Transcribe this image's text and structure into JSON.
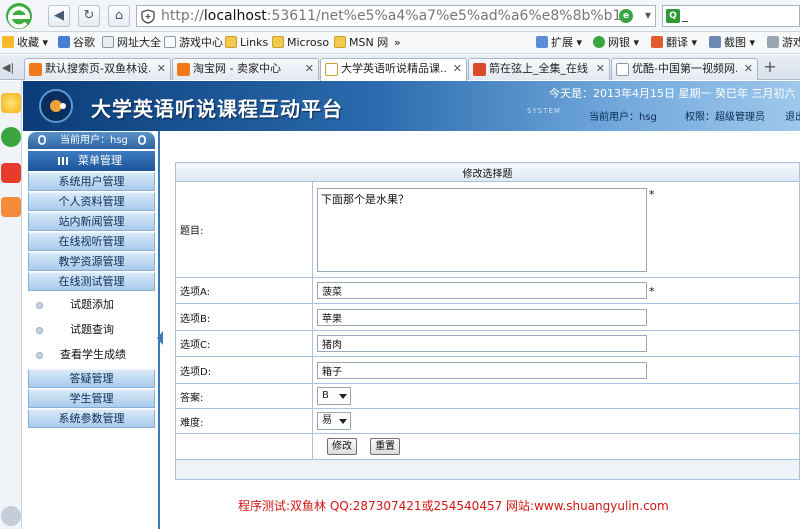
{
  "browser": {
    "url_prefix": "http://",
    "url_host": "localhost",
    "url_rest": ":53611/net%e5%a4%a7%e5%ad%a6%e8%8b%b1%e8%af%a",
    "search_cursor": "_",
    "new_tab_label": "+"
  },
  "favorites": {
    "left": [
      {
        "label": "收藏",
        "icon": "star-icon"
      },
      {
        "label": "谷歌",
        "icon": "google-icon"
      },
      {
        "label": "网址大全",
        "icon": "url-directory-icon"
      },
      {
        "label": "游戏中心",
        "icon": "page-icon"
      },
      {
        "label": "Links",
        "icon": "folder-icon"
      },
      {
        "label": "Microso",
        "icon": "folder-icon"
      },
      {
        "label": "MSN 网",
        "icon": "folder-icon"
      },
      {
        "label": "»",
        "icon": ""
      }
    ],
    "right": [
      {
        "label": "扩展",
        "icon": "extensions-icon"
      },
      {
        "label": "网银",
        "icon": "netbank-icon"
      },
      {
        "label": "翻译",
        "icon": "translate-icon"
      },
      {
        "label": "截图",
        "icon": "screenshot-icon"
      },
      {
        "label": "游戏",
        "icon": "game-icon"
      }
    ]
  },
  "tabs": [
    {
      "label": "默认搜索页-双鱼林设...",
      "icon": "taobao-icon"
    },
    {
      "label": "淘宝网 - 卖家中心",
      "icon": "taobao-icon"
    },
    {
      "label": "大学英语听说精品课...",
      "icon": "asp-icon",
      "active": true
    },
    {
      "label": "箭在弦上_全集_在线...",
      "icon": "ku-icon"
    },
    {
      "label": "优酷-中国第一视频网...",
      "icon": "page-icon"
    }
  ],
  "header": {
    "title": "大学英语听说课程互动平台",
    "today": "今天是：2013年4月15日 星期一 癸巳年 三月初六",
    "system_tag": "SYSTEM",
    "current_user": "当前用户：hsg",
    "permission": "权限：超级管理员",
    "logout": "退出"
  },
  "sidebar": {
    "current_user": "当前用户：hsg",
    "menu_title": "菜单管理",
    "groups": [
      {
        "label": "系统用户管理"
      },
      {
        "label": "个人资料管理"
      },
      {
        "label": "站内新闻管理"
      },
      {
        "label": "在线视听管理"
      },
      {
        "label": "教学资源管理"
      },
      {
        "label": "在线测试管理"
      }
    ],
    "sub_items": [
      {
        "label": "试题添加"
      },
      {
        "label": "试题查询"
      },
      {
        "label": "查看学生成绩"
      }
    ],
    "groups_after": [
      {
        "label": "答疑管理"
      },
      {
        "label": "学生管理"
      },
      {
        "label": "系统参数管理"
      }
    ]
  },
  "form": {
    "caption": "修改选择题",
    "question_label": "题目:",
    "question_value": "下面那个是水果？",
    "required_mark": "*",
    "options": [
      {
        "label": "选项A:",
        "value": "菠菜",
        "required": true
      },
      {
        "label": "选项B:",
        "value": "苹果",
        "required": false
      },
      {
        "label": "选项C:",
        "value": "猪肉",
        "required": false
      },
      {
        "label": "选项D:",
        "value": "箱子",
        "required": false
      }
    ],
    "answer_label": "答案:",
    "answer_value": "B",
    "difficulty_label": "难度:",
    "difficulty_value": "易",
    "modify_button": "修改",
    "reset_button": "重置"
  },
  "footer": {
    "credit": "程序测试:双鱼林 QQ:287307421或254540457 网站:www.shuangyulin.com"
  }
}
